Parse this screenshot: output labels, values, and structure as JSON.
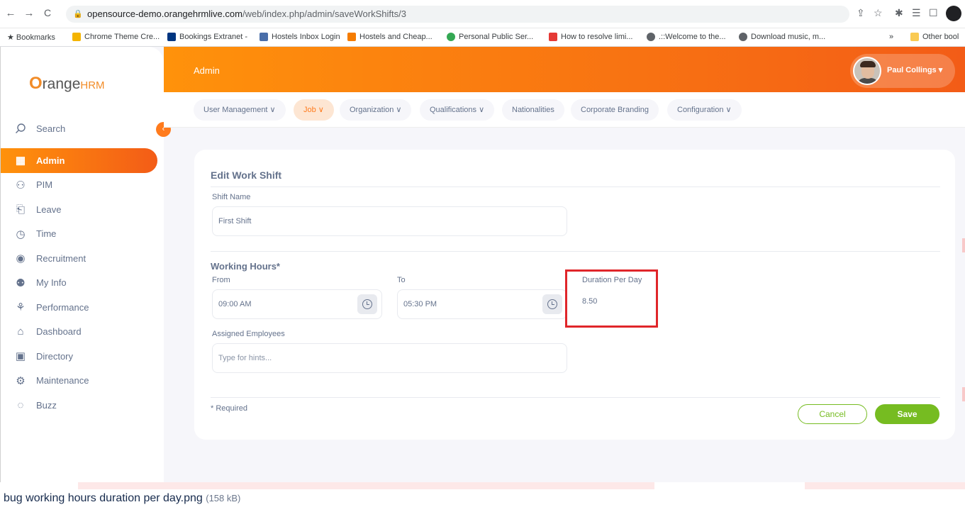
{
  "browser": {
    "url_domain": "opensource-demo.orangehrmlive.com",
    "url_path": "/web/index.php/admin/saveWorkShifts/3",
    "back_glyph": "←",
    "forward_glyph": "→",
    "reload_glyph": "C",
    "lock_glyph": "🔒",
    "share_glyph": "⇪",
    "star_glyph": "☆",
    "ext_glyph": "✱",
    "menu_glyph": "☰",
    "panel_glyph": "☐",
    "bookmarks": [
      {
        "label": "★ Bookmarks",
        "color": ""
      },
      {
        "label": "Chrome Theme Cre...",
        "color": "#f4b400"
      },
      {
        "label": "Bookings Extranet -",
        "color": "#003580"
      },
      {
        "label": "Hostels Inbox Login",
        "color": "#4a6ea9"
      },
      {
        "label": "Hostels and Cheap...",
        "color": "#f57c00"
      },
      {
        "label": "Personal Public Ser...",
        "color": "#34a853"
      },
      {
        "label": "How to resolve limi...",
        "color": "#e53935"
      },
      {
        "label": ".::Welcome to the...",
        "color": "#5f6368"
      },
      {
        "label": "Download music, m...",
        "color": "#5f6368"
      }
    ],
    "overflow_label": "»",
    "other_bookmarks": "Other bool"
  },
  "app": {
    "logo_o": "O",
    "logo_range": "range",
    "logo_hrm": "HRM",
    "search_label": "Search",
    "collapse_glyph": "‹",
    "menu": [
      {
        "label": "Admin",
        "icon": "▦",
        "active": true
      },
      {
        "label": "PIM",
        "icon": "⚇",
        "active": false
      },
      {
        "label": "Leave",
        "icon": "⎗",
        "active": false
      },
      {
        "label": "Time",
        "icon": "◷",
        "active": false
      },
      {
        "label": "Recruitment",
        "icon": "◉",
        "active": false
      },
      {
        "label": "My Info",
        "icon": "⚉",
        "active": false
      },
      {
        "label": "Performance",
        "icon": "⚘",
        "active": false
      },
      {
        "label": "Dashboard",
        "icon": "⌂",
        "active": false
      },
      {
        "label": "Directory",
        "icon": "▣",
        "active": false
      },
      {
        "label": "Maintenance",
        "icon": "⚙",
        "active": false
      },
      {
        "label": "Buzz",
        "icon": "◌",
        "active": false
      }
    ],
    "topbar_title": "Admin",
    "user_name": "Paul Collings ▾",
    "tabs": [
      {
        "label": "User Management ∨",
        "active": false
      },
      {
        "label": "Job ∨",
        "active": true
      },
      {
        "label": "Organization ∨",
        "active": false
      },
      {
        "label": "Qualifications ∨",
        "active": false
      },
      {
        "label": "Nationalities",
        "active": false
      },
      {
        "label": "Corporate Branding",
        "active": false
      },
      {
        "label": "Configuration ∨",
        "active": false
      }
    ]
  },
  "form": {
    "title": "Edit Work Shift",
    "shift_name_label": "Shift Name",
    "shift_name_value": "First Shift",
    "working_hours_label": "Working Hours*",
    "from_label": "From",
    "from_value": "09:00 AM",
    "to_label": "To",
    "to_value": "05:30 PM",
    "duration_label": "Duration Per Day",
    "duration_value": "8.50",
    "assigned_label": "Assigned Employees",
    "assigned_placeholder": "Type for hints...",
    "required_note": "* Required",
    "cancel_label": "Cancel",
    "save_label": "Save"
  },
  "caption": {
    "filename": "bug working hours duration per day.png",
    "size": "(158 kB)"
  },
  "colors": {
    "accent_orange": "#ff7b1d",
    "save_green": "#76bc21",
    "highlight_red": "#e0262a"
  }
}
